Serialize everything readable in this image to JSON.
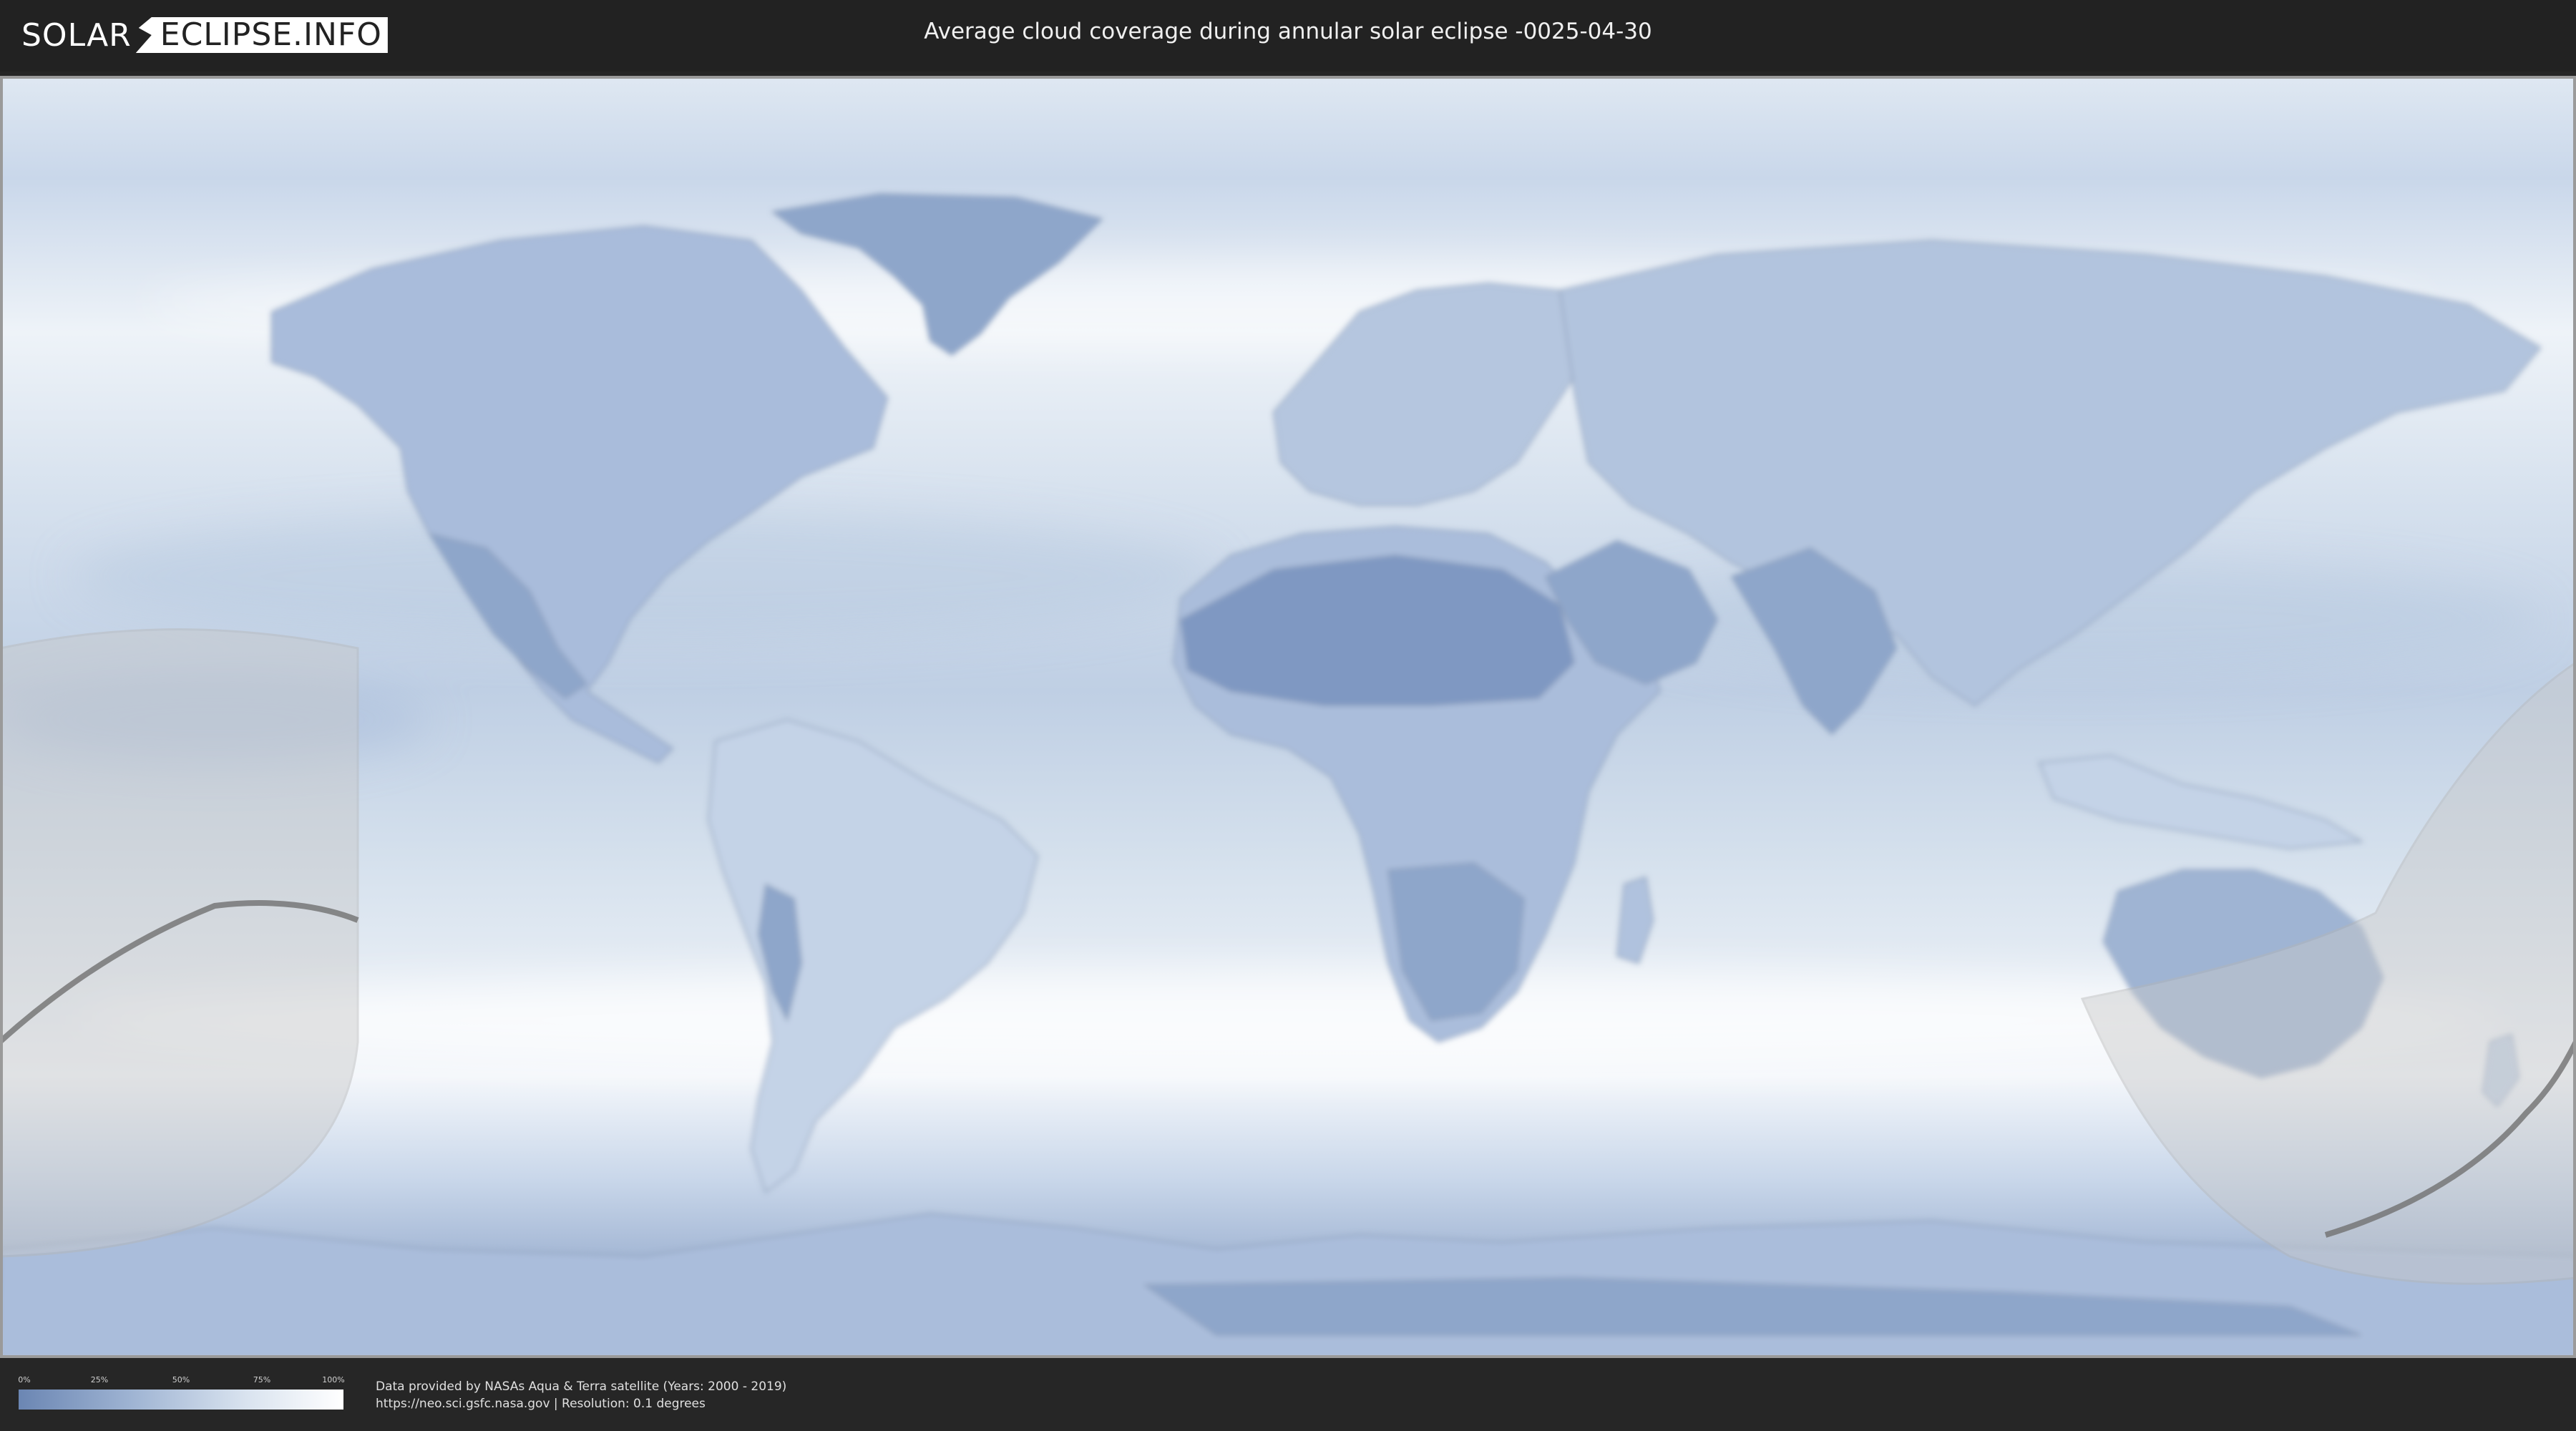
{
  "header": {
    "logo_part1": "SOLAR",
    "logo_part2": "ECLIPSE.INFO",
    "title": "Average cloud coverage during annular solar eclipse -0025-04-30"
  },
  "legend": {
    "ticks": [
      "0%",
      "25%",
      "50%",
      "75%",
      "100%"
    ],
    "gradient_colors": [
      "#6b86b3",
      "#9fb4d3",
      "#d9e3ef",
      "#ffffff"
    ]
  },
  "footer": {
    "data_credit": "Data provided by NASAs Aqua & Terra satellite (Years: 2000 - 2019)",
    "source_info": "https://neo.sci.gsfc.nasa.gov | Resolution: 0.1 degrees"
  },
  "colors": {
    "cloud_clear": "#7b95be",
    "cloud_full": "#ffffff",
    "eclipse_overlay": "#c8c8c8",
    "central_path": "#707070"
  }
}
